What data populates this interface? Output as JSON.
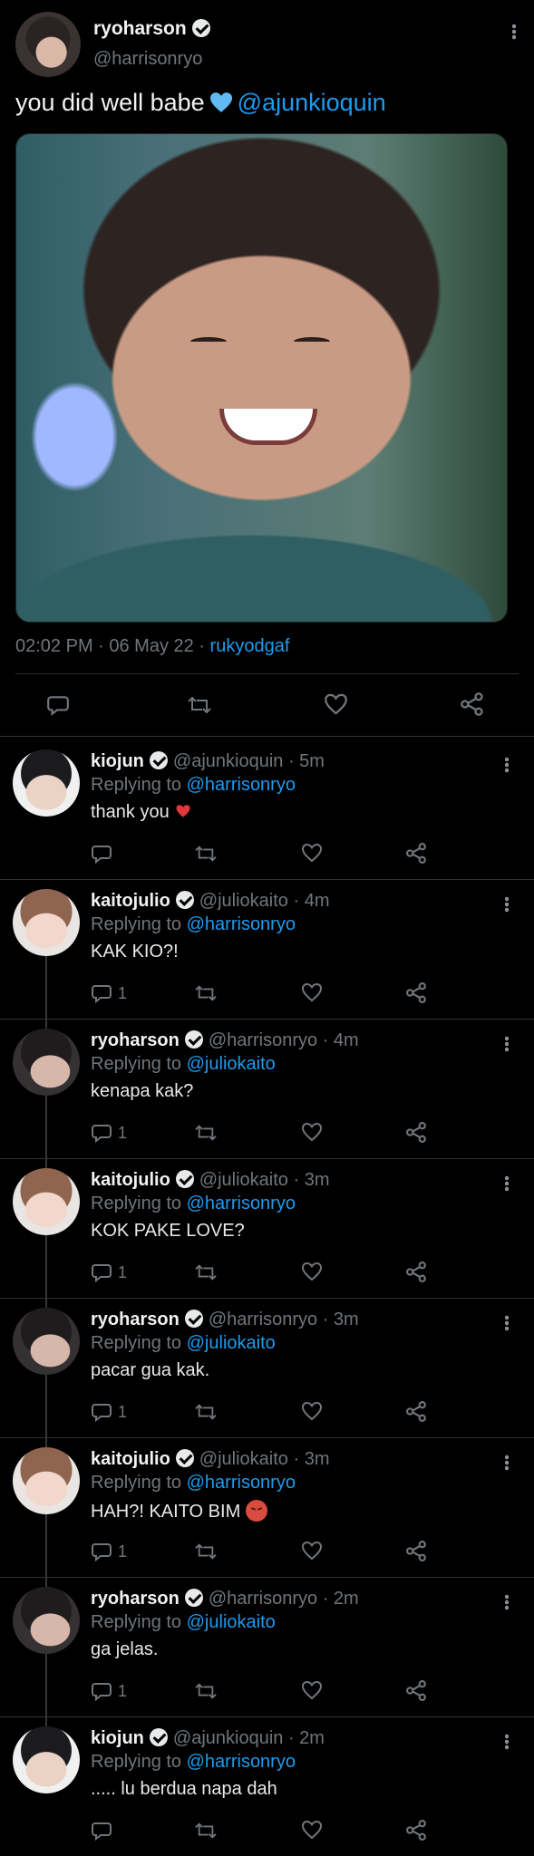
{
  "main_tweet": {
    "name": "ryoharson",
    "handle": "@harrisonryo",
    "text": "you did well babe",
    "mention": "@ajunkioquin",
    "timestamp": "02:02 PM · 06 May 22 · ",
    "source": "rukyodgaf"
  },
  "replies": [
    {
      "name": "kiojun",
      "handle": "@ajunkioquin · 5m",
      "replying_prefix": "Replying to ",
      "replying_to": "@harrisonryo",
      "text": "thank you",
      "reply_count": "",
      "avatar": "kio"
    },
    {
      "name": "kaitojulio",
      "handle": "@juliokaito · 4m",
      "replying_prefix": "Replying to ",
      "replying_to": "@harrisonryo",
      "text": "KAK KIO?!",
      "reply_count": "1",
      "avatar": "kaito"
    },
    {
      "name": "ryoharson",
      "handle": "@harrisonryo · 4m",
      "replying_prefix": "Replying to ",
      "replying_to": "@juliokaito",
      "text": "kenapa kak?",
      "reply_count": "1",
      "avatar": "ryo"
    },
    {
      "name": "kaitojulio",
      "handle": "@juliokaito · 3m",
      "replying_prefix": "Replying to ",
      "replying_to": "@harrisonryo",
      "text": "KOK PAKE LOVE?",
      "reply_count": "1",
      "avatar": "kaito"
    },
    {
      "name": "ryoharson",
      "handle": "@harrisonryo · 3m",
      "replying_prefix": "Replying to ",
      "replying_to": "@juliokaito",
      "text": " pacar gua kak.",
      "reply_count": "1",
      "avatar": "ryo"
    },
    {
      "name": "kaitojulio",
      "handle": "@juliokaito · 3m",
      "replying_prefix": "Replying to ",
      "replying_to": "@harrisonryo",
      "text": "HAH?! KAITO BIM",
      "reply_count": "1",
      "avatar": "kaito"
    },
    {
      "name": "ryoharson",
      "handle": "@harrisonryo · 2m",
      "replying_prefix": "Replying to ",
      "replying_to": "@juliokaito",
      "text": "ga jelas.",
      "reply_count": "1",
      "avatar": "ryo"
    },
    {
      "name": "kiojun",
      "handle": "@ajunkioquin · 2m",
      "replying_prefix": "Replying to ",
      "replying_to": "@harrisonryo",
      "text": "..... lu berdua napa dah",
      "reply_count": "",
      "avatar": "kio"
    }
  ],
  "icons": {
    "reply": "reply-icon",
    "retweet": "retweet-icon",
    "like": "heart-icon",
    "share": "share-icon",
    "more": "more-icon"
  }
}
